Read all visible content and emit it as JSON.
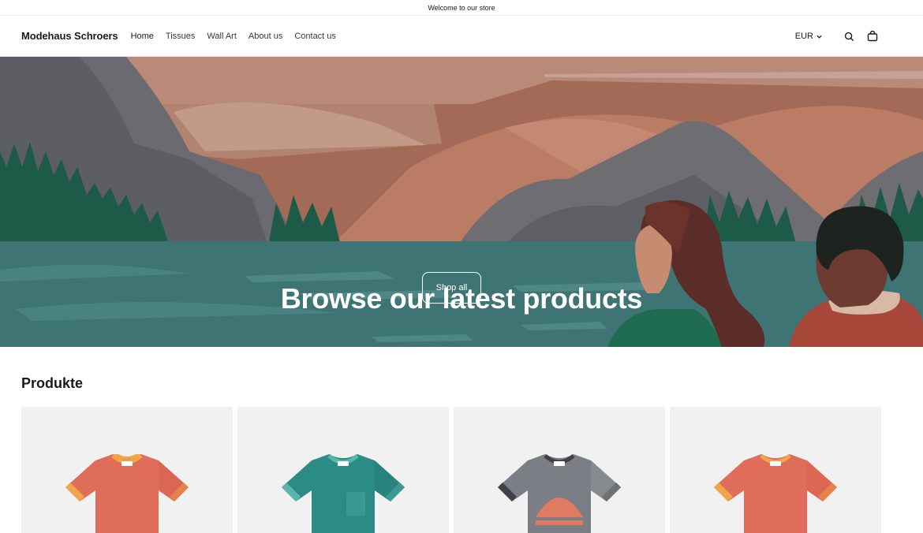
{
  "announcement": {
    "text": "Welcome to our store"
  },
  "header": {
    "logo": "Modehaus Schroers",
    "nav": [
      "Home",
      "Tissues",
      "Wall Art",
      "About us",
      "Contact us"
    ],
    "currency": "EUR"
  },
  "hero": {
    "title": "Browse our latest products",
    "button_label": "Shop all"
  },
  "products_section": {
    "title": "Produkte",
    "items": [
      {
        "image": "tshirt-coral",
        "color": "#e06c5a"
      },
      {
        "image": "tshirt-teal",
        "color": "#2a8c85"
      },
      {
        "image": "tshirt-gray",
        "color": "#7b7f85"
      },
      {
        "image": "tshirt-coral",
        "color": "#e06c5a"
      }
    ]
  }
}
